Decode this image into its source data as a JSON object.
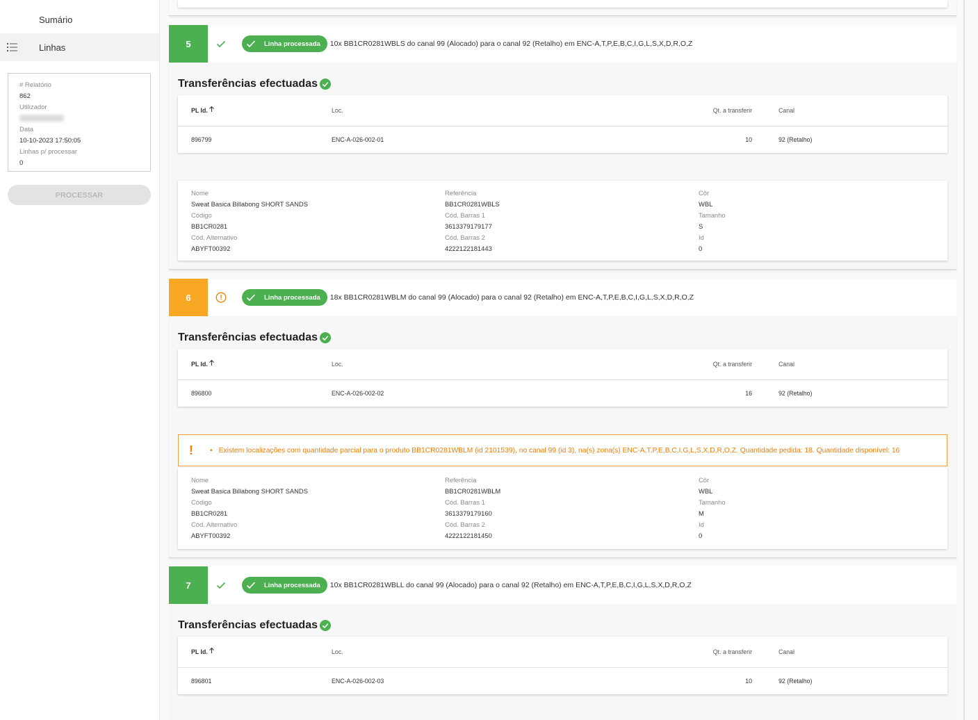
{
  "sidebar": {
    "summary_label": "Sumário",
    "lines_label": "Linhas",
    "report_label": "# Relatório",
    "report_value": "862",
    "user_label": "Utilizador",
    "date_label": "Data",
    "date_value": "10-10-2023 17:50:05",
    "pending_label": "Linhas p/ processar",
    "pending_value": "0",
    "process_button": "PROCESSAR"
  },
  "labels": {
    "processed_chip": "Linha processada",
    "transfers_title": "Transferências efectuadas",
    "col_pl": "PL Id.",
    "col_loc": "Loc.",
    "col_qty": "Qt. a transferir",
    "col_canal": "Canal",
    "name": "Nome",
    "code": "Código",
    "alt_code": "Cód. Alternativo",
    "reference": "Referência",
    "barcode1": "Cód. Barras 1",
    "barcode2": "Cód. Barras 2",
    "color": "Côr",
    "size": "Tamanho",
    "id": "Id"
  },
  "lines": [
    {
      "number": "5",
      "status": "ok",
      "description": "10x BB1CR0281WBLS do canal 99 (Alocado) para o canal 92 (Retalho) em ENC-A,T,P,E,B,C,I,G,L,S,X,D,R,O,Z",
      "row": {
        "pl": "896799",
        "loc": "ENC-A-026-002-01",
        "qty": "10",
        "canal": "92 (Retalho)"
      },
      "product": {
        "name": "Sweat Basica Billabong SHORT SANDS",
        "code": "BB1CR0281",
        "alt_code": "ABYFT00392",
        "reference": "BB1CR0281WBLS",
        "barcode1": "3613379179177",
        "barcode2": "4222122181443",
        "color": "WBL",
        "size": "S",
        "id": "0"
      }
    },
    {
      "number": "6",
      "status": "warn",
      "description": "18x BB1CR0281WBLM do canal 99 (Alocado) para o canal 92 (Retalho) em ENC-A,T,P,E,B,C,I,G,L,S,X,D,R,O,Z",
      "row": {
        "pl": "896800",
        "loc": "ENC-A-026-002-02",
        "qty": "16",
        "canal": "92 (Retalho)"
      },
      "warning": "Existem localizações com quantidade parcial para o produto BB1CR0281WBLM (id 2101539), no canal 99 (id 3), na(s) zona(s) ENC-A,T,P,E,B,C,I,G,L,S,X,D,R,O,Z. Quantidade pedida: 18. Quantidade disponível: 16",
      "product": {
        "name": "Sweat Basica Billabong SHORT SANDS",
        "code": "BB1CR0281",
        "alt_code": "ABYFT00392",
        "reference": "BB1CR0281WBLM",
        "barcode1": "3613379179160",
        "barcode2": "4222122181450",
        "color": "WBL",
        "size": "M",
        "id": "0"
      }
    },
    {
      "number": "7",
      "status": "ok",
      "description": "10x BB1CR0281WBLL do canal 99 (Alocado) para o canal 92 (Retalho) em ENC-A,T,P,E,B,C,I,G,L,S,X,D,R,O,Z",
      "row": {
        "pl": "896801",
        "loc": "ENC-A-026-002-03",
        "qty": "10",
        "canal": "92 (Retalho)"
      }
    }
  ],
  "colors": {
    "success": "#4caf50",
    "warning": "#f9a825",
    "warning_text": "#f57c00"
  }
}
